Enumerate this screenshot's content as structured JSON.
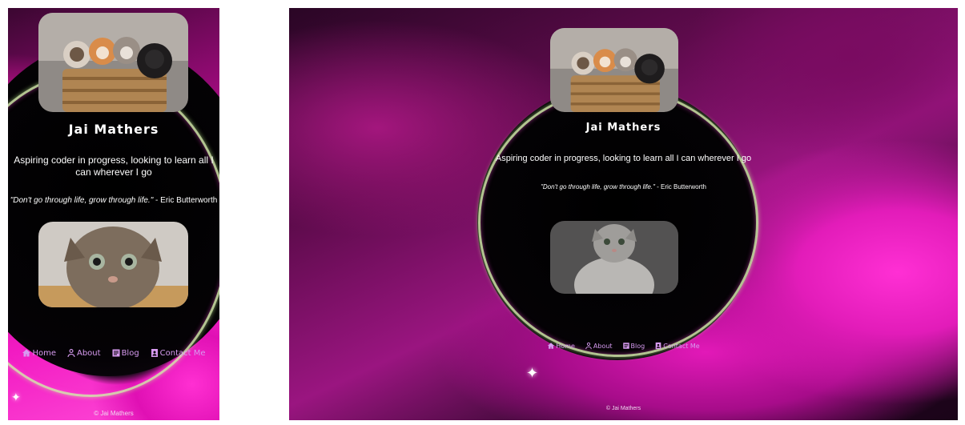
{
  "profile": {
    "name": "Jai Mathers",
    "bio": "Aspiring coder in progress, looking to learn all I can wherever I go",
    "quote_text": "\"Don't go through life, grow through life.\"",
    "quote_author": " - Eric Butterworth"
  },
  "images": {
    "kittens_basket": {
      "label": "four kittens in a wicker basket"
    },
    "kitten_closeup": {
      "label": "tabby kitten close-up"
    },
    "kitten_grey": {
      "label": "grey kitten portrait"
    }
  },
  "nav": {
    "items": [
      {
        "label": "Home",
        "icon": "home-icon"
      },
      {
        "label": "About",
        "icon": "user-icon"
      },
      {
        "label": "Blog",
        "icon": "blog-icon"
      },
      {
        "label": "Contact Me",
        "icon": "contact-icon"
      }
    ]
  },
  "footer": {
    "copyright": "© Jai Mathers"
  },
  "colors": {
    "background_magenta": "#e21cb9",
    "portal_black": "#040205",
    "nav_text": "#d79bf0",
    "text": "#ffffff"
  }
}
